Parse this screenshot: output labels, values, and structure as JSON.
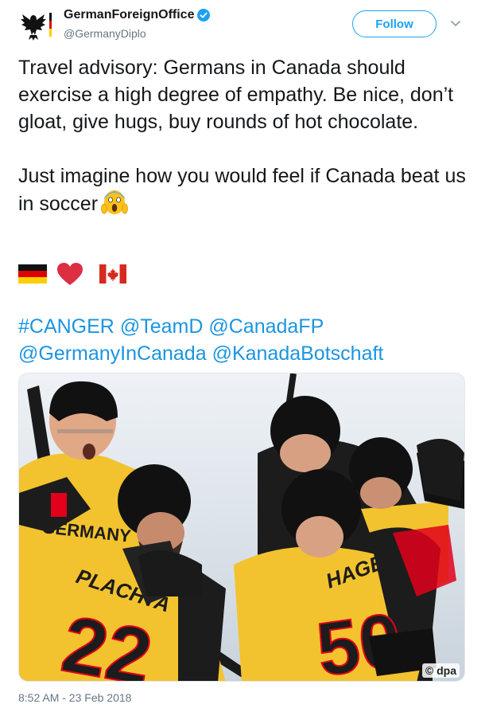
{
  "account": {
    "display_name": "GermanForeignOffice",
    "handle": "@GermanyDiplo",
    "verified": true
  },
  "follow_label": "Follow",
  "tweet": {
    "paragraph1": "Travel advisory: Germans in Canada should exercise a high degree of empathy. Be nice, don’t gloat, give hugs, buy rounds of hot chocolate.",
    "paragraph2": "Just imagine how you would feel if Canada beat us in soccer",
    "emojis": [
      "german-flag",
      "red-heart",
      "canada-flag"
    ],
    "hashtags_line1": [
      "#CANGER",
      "@TeamD",
      "@CanadaFP"
    ],
    "hashtags_line2": [
      "@GermanyInCanada",
      "@KanadaBotschaft"
    ]
  },
  "photo": {
    "credit": "© dpa",
    "jersey_text": [
      "GERMANY",
      "PLACHTA",
      "22",
      "HAGER",
      "50"
    ]
  },
  "timestamp": "8:52 AM - 23 Feb 2018",
  "colors": {
    "accent": "#1da1f2",
    "link": "#1b95e0",
    "muted": "#657786",
    "jersey_yellow": "#f2c32e",
    "jersey_black": "#1c1c1c"
  }
}
